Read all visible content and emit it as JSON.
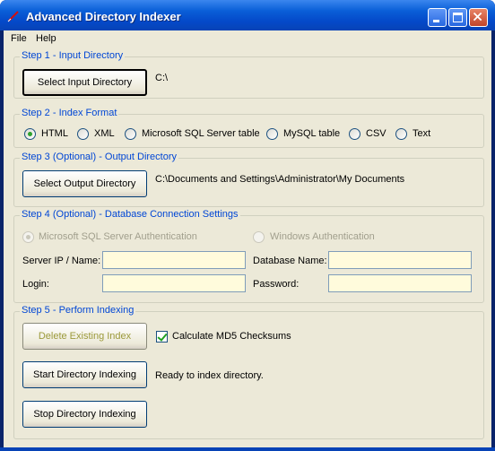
{
  "window": {
    "title": "Advanced Directory Indexer"
  },
  "menu": {
    "file": "File",
    "help": "Help"
  },
  "step1": {
    "legend": "Step 1 - Input Directory",
    "button": "Select Input Directory",
    "path": "C:\\"
  },
  "step2": {
    "legend": "Step 2 - Index Format",
    "options": [
      "HTML",
      "XML",
      "Microsoft SQL Server table",
      "MySQL table",
      "CSV",
      "Text"
    ],
    "selected": "HTML"
  },
  "step3": {
    "legend": "Step 3 (Optional) - Output Directory",
    "button": "Select Output Directory",
    "path": "C:\\Documents and Settings\\Administrator\\My Documents"
  },
  "step4": {
    "legend": "Step 4 (Optional) - Database Connection Settings",
    "auth_sql": "Microsoft SQL Server Authentication",
    "auth_windows": "Windows Authentication",
    "server_label": "Server IP / Name:",
    "server_value": "",
    "database_label": "Database Name:",
    "database_value": "",
    "login_label": "Login:",
    "login_value": "",
    "password_label": "Password:",
    "password_value": ""
  },
  "step5": {
    "legend": "Step 5 - Perform Indexing",
    "delete_button": "Delete Existing Index",
    "md5_label": "Calculate MD5 Checksums",
    "md5_checked": true,
    "start_button": "Start Directory Indexing",
    "status": "Ready to index directory.",
    "stop_button": "Stop Directory Indexing"
  }
}
